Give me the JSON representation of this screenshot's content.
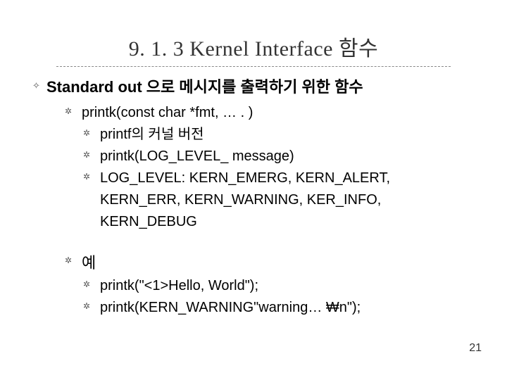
{
  "title": "9. 1. 3 Kernel Interface 함수",
  "section": {
    "heading": "Standard out 으로 메시지를 출력하기 위한 함수",
    "funcSignature": "printk(const char *fmt, … . )",
    "funcDetails": [
      "printf의 커널 버전",
      "printk(LOG_LEVEL_ message)",
      "LOG_LEVEL: KERN_EMERG, KERN_ALERT, KERN_ERR, KERN_WARNING, KER_INFO, KERN_DEBUG"
    ],
    "exampleHeading": "예",
    "examples": [
      "printk(\"<1>Hello, World\");",
      "printk(KERN_WARNING\"warning… ₩n\");"
    ]
  },
  "pageNumber": "21"
}
